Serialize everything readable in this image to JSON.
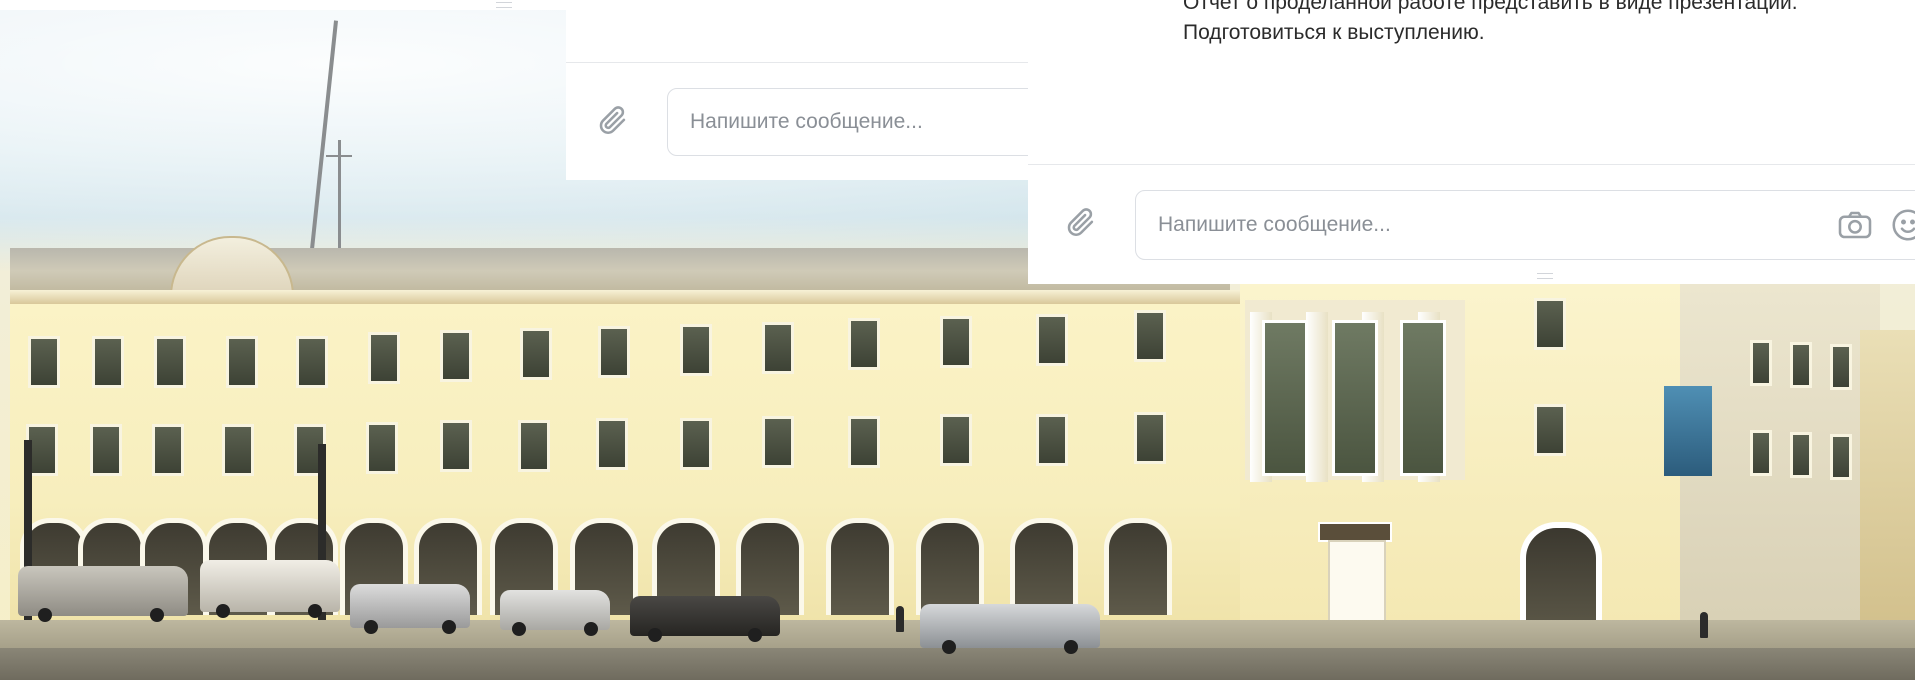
{
  "chat_left": {
    "input_placeholder": "Напишите сообщение..."
  },
  "chat_right": {
    "message_lines": [
      "Отчет о проделанной работе представить в виде презентации.",
      "Подготовиться к выступлению."
    ],
    "input_placeholder": "Напишите сообщение..."
  },
  "icons": {
    "attach": "paperclip-icon",
    "camera": "camera-icon",
    "emoji": "emoji-icon"
  },
  "colors": {
    "icon_gray": "#9aa0a6",
    "input_border": "#dcdfe4",
    "placeholder": "#8a8f96",
    "facade_yellow": "#f7eebd"
  }
}
